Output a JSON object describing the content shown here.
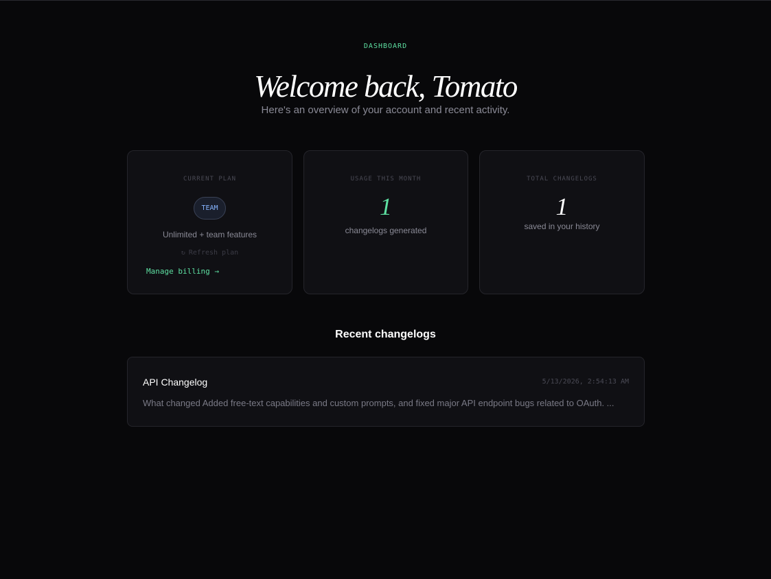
{
  "header": {
    "eyebrow": "DASHBOARD",
    "title": "Welcome back, Tomato",
    "subtitle": "Here's an overview of your account and recent activity."
  },
  "stats": {
    "plan": {
      "label": "CURRENT PLAN",
      "badge": "TEAM",
      "description": "Unlimited + team features",
      "refresh_icon": "refresh-icon",
      "refresh_glyph": "↻",
      "refresh_label": "Refresh plan",
      "billing_label": "Manage billing →"
    },
    "usage": {
      "label": "USAGE THIS MONTH",
      "value": "1",
      "caption": "changelogs generated"
    },
    "total": {
      "label": "TOTAL CHANGELOGS",
      "value": "1",
      "caption": "saved in your history"
    }
  },
  "recent": {
    "title": "Recent changelogs",
    "items": [
      {
        "title": "API Changelog",
        "date": "5/13/2026, 2:54:13 AM",
        "summary": "What changed Added free-text capabilities and custom prompts, and fixed major API endpoint bugs related to OAuth. ..."
      }
    ]
  },
  "colors": {
    "background": "#08080a",
    "card": "#101014",
    "accent_green": "#5ee0a2",
    "accent_blue": "#86b4ff"
  }
}
